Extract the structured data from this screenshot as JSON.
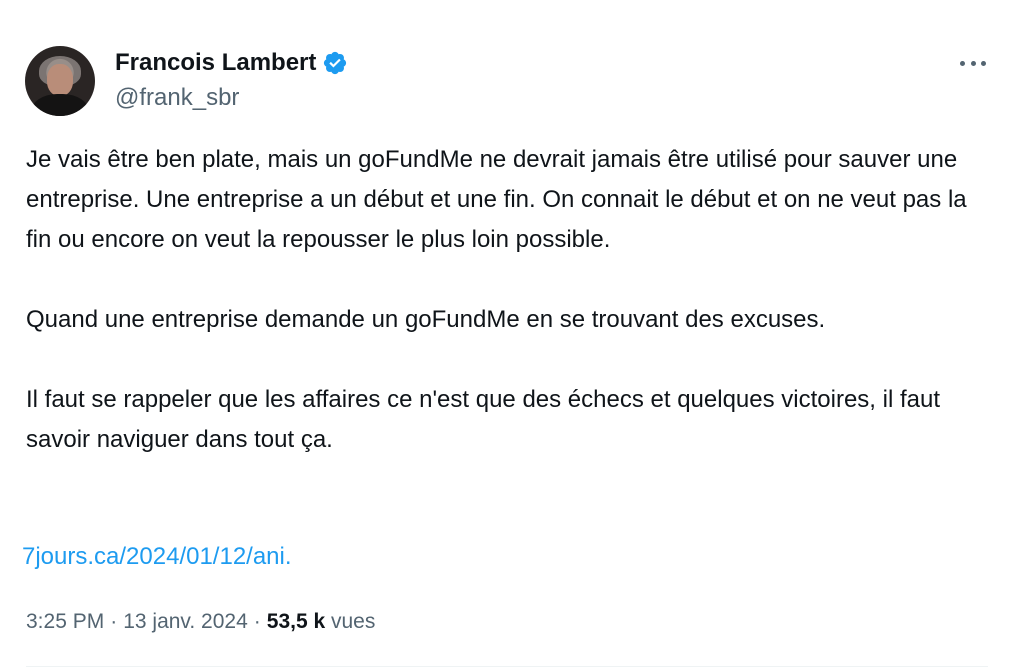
{
  "author": {
    "display_name": "Francois Lambert",
    "handle": "@frank_sbr",
    "verified": true
  },
  "tweet": {
    "paragraphs": [
      "Je vais être ben plate, mais un goFundMe ne devrait jamais être utilisé pour sauver une entreprise. Une entreprise a un début et une fin. On connait le début et on ne veut pas la fin ou encore on veut la repousser le plus loin possible.",
      "Quand une entreprise demande un goFundMe en se trouvant des excuses.",
      "Il faut se rappeler que les affaires ce n'est que des échecs et quelques victoires, il faut savoir naviguer dans tout ça."
    ],
    "link_text": "7jours.ca/2024/01/12/ani."
  },
  "meta": {
    "time": "3:25 PM",
    "separator": "·",
    "date": "13 janv. 2024",
    "views_count": "53,5 k",
    "views_label": "vues"
  },
  "colors": {
    "accent": "#1d9bf0",
    "text_primary": "#0f1419",
    "text_secondary": "#536471",
    "divider": "#eff3f4"
  },
  "icons": {
    "verified": "verified-badge-icon",
    "more": "more-options-icon"
  }
}
